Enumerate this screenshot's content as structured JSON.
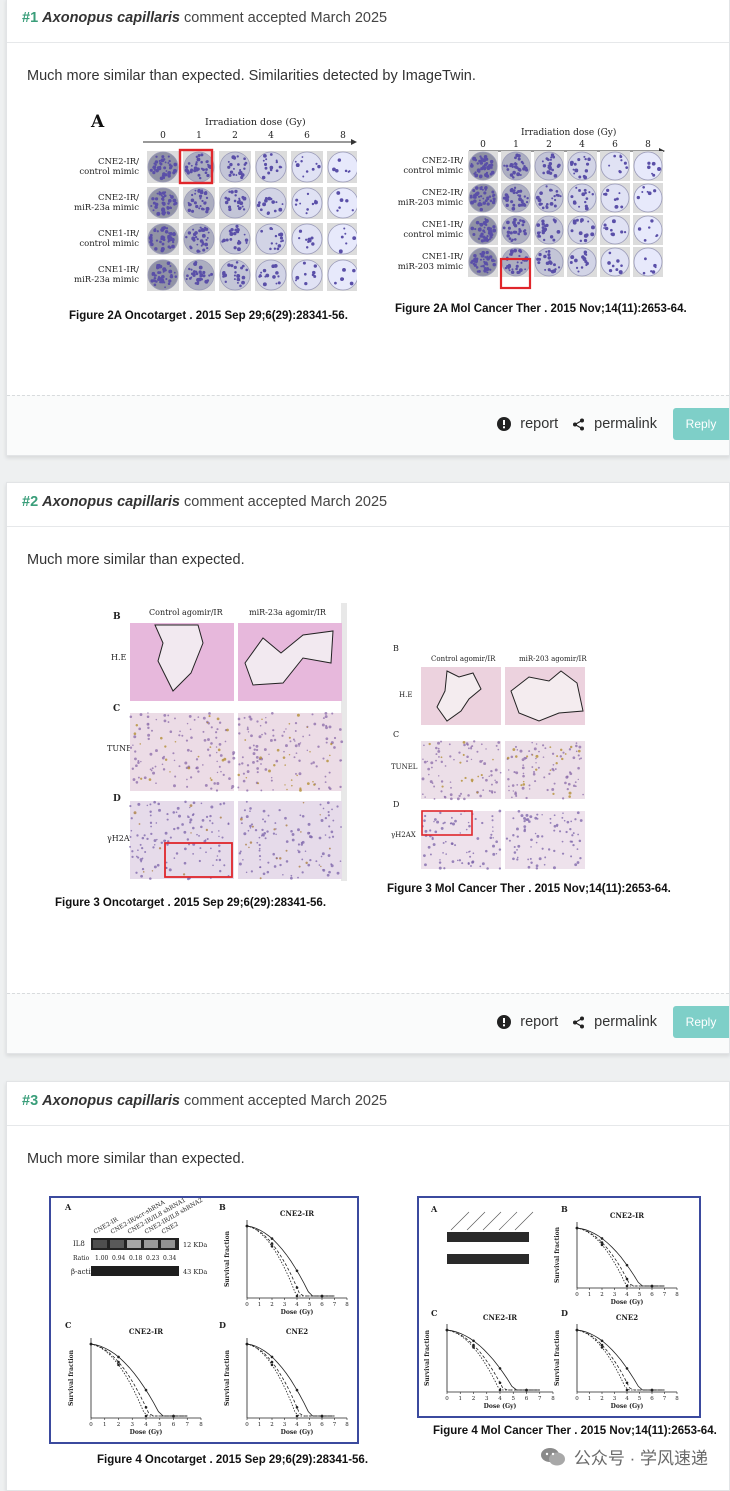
{
  "comments": [
    {
      "number": "#1",
      "author": "Axonopus capillaris",
      "status": "comment accepted March 2025",
      "body": "Much more similar than expected. Similarities detected by ImageTwin.",
      "left_figure": {
        "panel_letter": "A",
        "axis_title": "Irradiation dose (Gy)",
        "doses": [
          "0",
          "1",
          "2",
          "4",
          "6",
          "8"
        ],
        "rows": [
          "CNE2-IR/\ncontrol mimic",
          "CNE2-IR/\nmiR-23a mimic",
          "CNE1-IR/\ncontrol mimic",
          "CNE1-IR/\nmiR-23a mimic"
        ],
        "caption": "Figure 2A Oncotarget . 2015 Sep 29;6(29):28341-56."
      },
      "right_figure": {
        "axis_title": "Irradiation dose (Gy)",
        "doses": [
          "0",
          "1",
          "2",
          "4",
          "6",
          "8"
        ],
        "rows": [
          "CNE2-IR/\ncontrol mimic",
          "CNE2-IR/\nmiR-203 mimic",
          "CNE1-IR/\ncontrol mimic",
          "CNE1-IR/\nmiR-203 mimic"
        ],
        "caption": "Figure 2A Mol Cancer Ther . 2015 Nov;14(11):2653-64."
      },
      "actions": {
        "report": "report",
        "permalink": "permalink",
        "reply": "Reply"
      }
    },
    {
      "number": "#2",
      "author": "Axonopus capillaris",
      "status": "comment accepted March 2025",
      "body": "Much more similar than expected.",
      "left_figure": {
        "col_labels": [
          "Control agomir/IR",
          "miR-23a agomir/IR"
        ],
        "panels": [
          "B",
          "C",
          "D"
        ],
        "row_labels": [
          "H.E",
          "TUNEL",
          "γH2AX"
        ],
        "caption": "Figure 3 Oncotarget . 2015 Sep 29;6(29):28341-56."
      },
      "right_figure": {
        "col_labels": [
          "Control agomir/IR",
          "miR-203 agomir/IR"
        ],
        "panels": [
          "B",
          "C",
          "D"
        ],
        "row_labels": [
          "H.E",
          "TUNEL",
          "γH2AX"
        ],
        "caption": "Figure 3 Mol Cancer Ther . 2015 Nov;14(11):2653-64."
      },
      "actions": {
        "report": "report",
        "permalink": "permalink",
        "reply": "Reply"
      }
    },
    {
      "number": "#3",
      "author": "Axonopus capillaris",
      "status": "comment accepted March 2025",
      "body": "Much more similar than expected.",
      "left_figure": {
        "panels": [
          "A",
          "B",
          "C",
          "D"
        ],
        "blot_lanes": [
          "CNE2-IR",
          "CNE2-IR/scr-shRNA",
          "CNE2-IR/IL8 shRNA1",
          "CNE2-IR/IL8 shRNA2",
          "CNE2"
        ],
        "blot_rows": [
          "IL8",
          "β-actin"
        ],
        "ratio_label": "Ratio",
        "ratios": [
          "1.00",
          "0.94",
          "0.18",
          "0.23",
          "0.34"
        ],
        "kda": [
          "12 KDa",
          "43 KDa"
        ],
        "plot_titles": [
          "CNE2-IR",
          "CNE2-IR",
          "CNE2"
        ],
        "ylabel": "Survival fraction",
        "xlabel": "Dose (Gy)",
        "caption": "Figure 4 Oncotarget . 2015 Sep 29;6(29):28341-56."
      },
      "right_figure": {
        "panels": [
          "A",
          "B",
          "C",
          "D"
        ],
        "plot_titles": [
          "CNE2-IR",
          "CNE2-IR",
          "CNE2"
        ],
        "ylabel": "Survival fraction",
        "xlabel": "Dose (Gy)",
        "caption": "Figure 4 Mol Cancer Ther . 2015 Nov;14(11):2653-64."
      }
    }
  ],
  "watermark": "公众号 · 学风速递",
  "colors": {
    "accent": "#3a9e7a",
    "reply": "#7ecfc8",
    "frame": "#3b4a9e",
    "highlight": "#e0262b"
  }
}
